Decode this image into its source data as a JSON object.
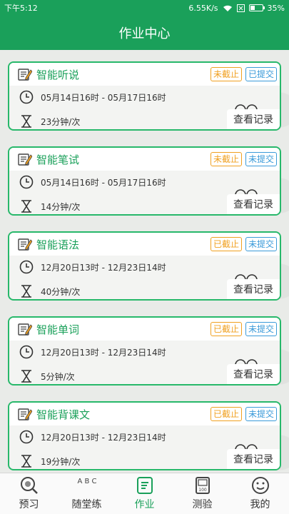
{
  "status": {
    "time": "下午5:12",
    "speed": "6.55K/s",
    "battery": "35%",
    "battery_level": 0.35
  },
  "header": {
    "title": "作业中心"
  },
  "cards": [
    {
      "title": "智能听说",
      "deadline": "未截止",
      "deadline_color": "#f0a020",
      "submit": "已提交",
      "submit_color": "#3a9ad9",
      "time": "05月14日16时 - 05月17日16时",
      "duration": "23分钟/次",
      "record": "查看记录"
    },
    {
      "title": "智能笔试",
      "deadline": "未截止",
      "deadline_color": "#f0a020",
      "submit": "未提交",
      "submit_color": "#3a9ad9",
      "time": "05月14日16时 - 05月17日16时",
      "duration": "14分钟/次",
      "record": "查看记录"
    },
    {
      "title": "智能语法",
      "deadline": "已截止",
      "deadline_color": "#f0a020",
      "submit": "未提交",
      "submit_color": "#3a9ad9",
      "time": "12月20日13时 - 12月23日14时",
      "duration": "40分钟/次",
      "record": "查看记录"
    },
    {
      "title": "智能单词",
      "deadline": "已截止",
      "deadline_color": "#f0a020",
      "submit": "未提交",
      "submit_color": "#3a9ad9",
      "time": "12月20日13时 - 12月23日14时",
      "duration": "5分钟/次",
      "record": "查看记录"
    },
    {
      "title": "智能背课文",
      "deadline": "已截止",
      "deadline_color": "#f0a020",
      "submit": "未提交",
      "submit_color": "#3a9ad9",
      "time": "12月20日13时 - 12月23日14时",
      "duration": "19分钟/次",
      "record": "查看记录"
    }
  ],
  "tabs": [
    {
      "label": "预习",
      "icon": "magnifier-icon"
    },
    {
      "label": "随堂练",
      "icon": "abc-icon"
    },
    {
      "label": "作业",
      "icon": "homework-icon",
      "active": true
    },
    {
      "label": "测验",
      "icon": "test-paper-icon"
    },
    {
      "label": "我的",
      "icon": "smiley-icon"
    }
  ],
  "tab_abc": "A B C",
  "tab_test_num": "100",
  "colors": {
    "brand": "#1aa05a",
    "card_border": "#27b86a"
  }
}
